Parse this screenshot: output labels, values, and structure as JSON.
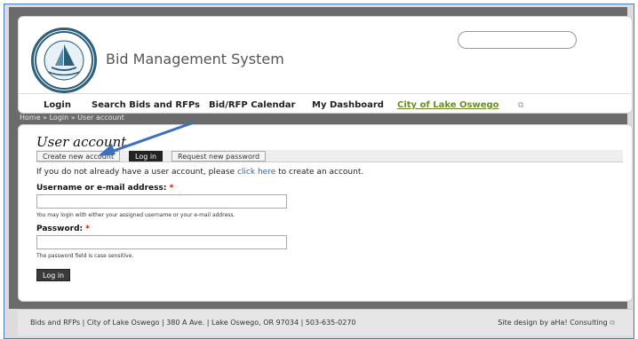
{
  "header": {
    "site_name": "Bid Management System",
    "logo_text": "CITY OF LAKE OSWEGO OREGON",
    "search_placeholder": ""
  },
  "nav": {
    "items": [
      {
        "label": "Login"
      },
      {
        "label": "Search Bids and RFPs"
      },
      {
        "label": "Bid/RFP Calendar"
      },
      {
        "label": "My Dashboard"
      },
      {
        "label": "City of Lake Oswego"
      }
    ]
  },
  "breadcrumb": "Home » Login » User account",
  "main": {
    "title": "User account",
    "tabs": [
      {
        "label": "Create new account"
      },
      {
        "label": "Log in"
      },
      {
        "label": "Request new password"
      }
    ],
    "intro_prefix": "If you do not already have a user account, please ",
    "intro_link": "click here",
    "intro_suffix": " to create an account.",
    "username": {
      "label": "Username or e-mail address:",
      "required": "*",
      "value": "",
      "help": "You may login with either your assigned username or your e-mail address."
    },
    "password": {
      "label": "Password:",
      "required": "*",
      "value": "",
      "help": "The password field is case sensitive."
    },
    "submit_label": "Log in"
  },
  "footer": {
    "left": "Bids and RFPs | City of Lake Oswego | 380 A Ave. | Lake Oswego, OR 97034 | 503-635-0270",
    "right": "Site design by aHa! Consulting"
  },
  "colors": {
    "accent_link": "#2a63b4",
    "external_link": "#6b8e23",
    "annotation_arrow": "#3d6fbf",
    "required": "#dd0000"
  },
  "icons": [
    "city-seal-logo",
    "external-link-icon",
    "annotation-arrow"
  ]
}
